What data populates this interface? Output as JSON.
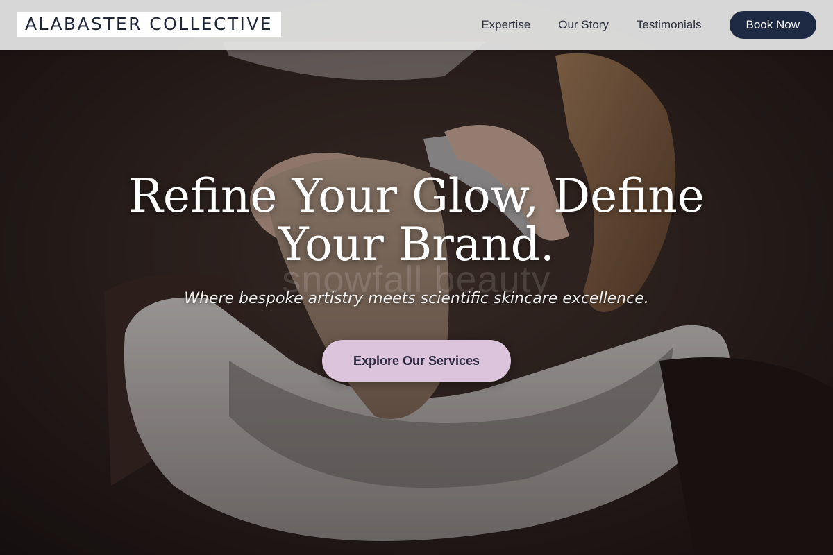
{
  "header": {
    "logo_text": "ALABASTER COLLECTIVE",
    "nav": [
      {
        "label": "Expertise"
      },
      {
        "label": "Our Story"
      },
      {
        "label": "Testimonials"
      }
    ],
    "book_button_label": "Book Now"
  },
  "hero": {
    "title": "Refine Your Glow, Define Your Brand.",
    "watermark_text": "snowfall beauty",
    "subtitle": "Where bespoke artistry meets scientific skincare excellence.",
    "cta_label": "Explore Our Services",
    "background_description": "salon hair washing scene"
  },
  "colors": {
    "header_bg": "#e8e8e8",
    "logo_text": "#1e2637",
    "book_button_bg": "#1e2a44",
    "cta_bg": "#dcc4dd",
    "cta_text": "#2c2940"
  }
}
